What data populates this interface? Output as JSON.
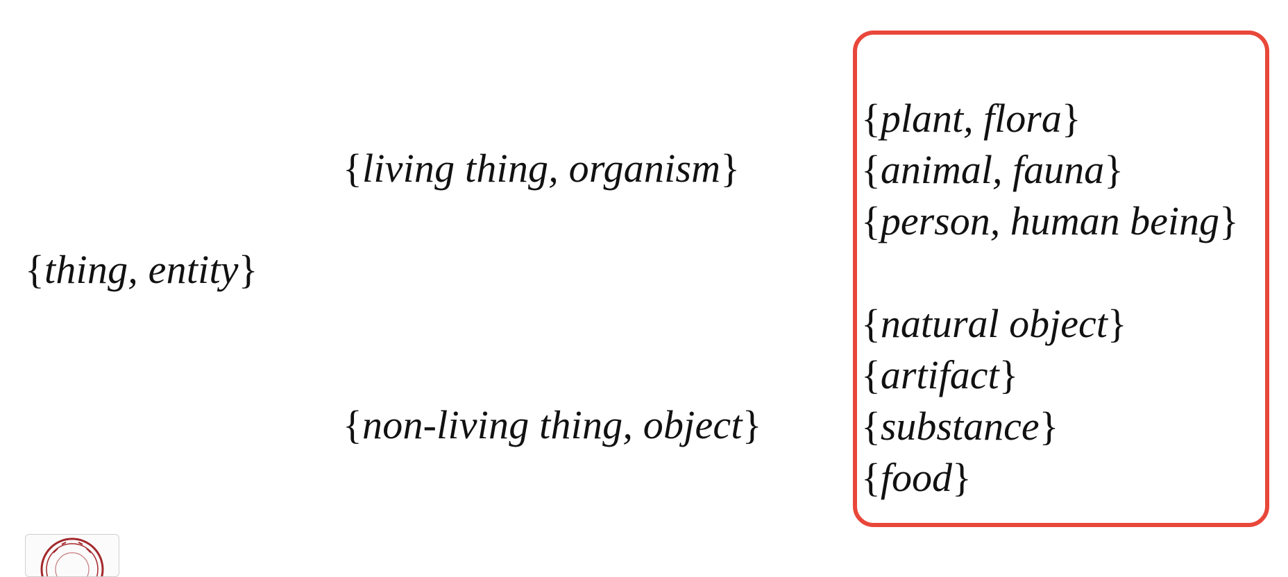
{
  "nodes": {
    "root": "thing, entity",
    "living": "living thing, organism",
    "nonliving": "non-living thing, object"
  },
  "living_children": [
    "plant, flora",
    "animal, fauna",
    "person, human being"
  ],
  "nonliving_children": [
    "natural object",
    "artifact",
    "substance",
    "food"
  ],
  "colors": {
    "highlight_border": "#e8473a",
    "text": "#111111",
    "seal": "#a3272c"
  },
  "icons": {
    "seal": "university-seal-icon"
  }
}
